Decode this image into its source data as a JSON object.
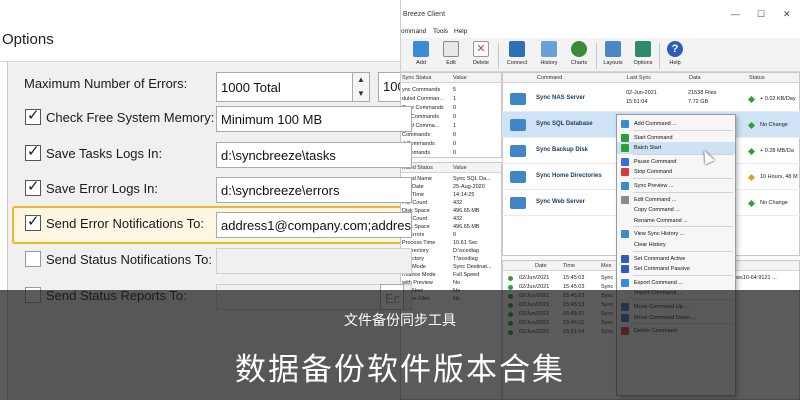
{
  "options_dialog": {
    "title": "Options",
    "max_errors": {
      "label": "Maximum Number of Errors:",
      "value": "1000 Total",
      "extra": "100"
    },
    "rows": [
      {
        "label": "Check Free System Memory:",
        "value": "Minimum 100 MB",
        "checked": true
      },
      {
        "label": "Save Tasks Logs In:",
        "value": "d:\\syncbreeze\\tasks",
        "checked": true
      },
      {
        "label": "Save Error Logs In:",
        "value": "d:\\syncbreeze\\errors",
        "checked": true
      },
      {
        "label": "Send Error Notifications To:",
        "value": "address1@company.com;address",
        "checked": true
      },
      {
        "label": "Send Status Notifications To:",
        "value": "",
        "checked": false
      },
      {
        "label": "Send Status Reports To:",
        "value": "",
        "checked": false
      }
    ],
    "extra_button": "Ec"
  },
  "app": {
    "title": "Breeze Client",
    "menu": [
      "ommand",
      "Tools",
      "Help"
    ],
    "toolbar": [
      "Add",
      "Edit",
      "Delete",
      "Connect",
      "History",
      "Charts",
      "Layouts",
      "Options",
      "Help"
    ],
    "status_panel": {
      "headers": [
        "Sync Status",
        "Value"
      ],
      "rows": [
        [
          "ync Commands",
          "5"
        ],
        [
          "duled Comman...",
          "1"
        ],
        [
          "Time Commands",
          "0"
        ],
        [
          "ing Commands",
          "0"
        ],
        [
          "leted Comma...",
          "1"
        ],
        [
          "Commands",
          "0"
        ],
        [
          "d Commands",
          "0"
        ],
        [
          "Commands",
          "0"
        ]
      ]
    },
    "detail_panel": {
      "headers": [
        "mand Status",
        "Value"
      ],
      "rows": [
        [
          "mand Name",
          "Sync SQL Da..."
        ],
        [
          "ync Date",
          "25-Aug-2020"
        ],
        [
          "ync Time",
          "14:14:25"
        ],
        [
          "File Count",
          "432"
        ],
        [
          "Disk Space",
          "496.65 MB"
        ],
        [
          "File Count",
          "432"
        ],
        [
          "Disk Space",
          "496.65 MB"
        ],
        [
          "nc Errors",
          "0"
        ],
        [
          "Process Time",
          "10.61 Sec"
        ],
        [
          "e Directory",
          "D:\\scediag"
        ],
        [
          "Directory",
          "T:\\scediag"
        ],
        [
          "ync Mode",
          "Sync Destinat..."
        ],
        [
          "rmance Mode",
          "Full Speed"
        ],
        [
          "with Preview",
          "No"
        ],
        [
          "ync Now",
          "No"
        ],
        [
          "rchive Files",
          "No"
        ]
      ]
    },
    "commands": {
      "headers": [
        "Command",
        "Last Sync",
        "Data",
        "Status"
      ],
      "rows": [
        {
          "name": "Sync NAS Server",
          "last_sync": "02-Jun-2021",
          "last_time": "15:51:04",
          "files": "21538 Files",
          "size": "7.72 GB",
          "status": "+ 0.02 KB/Day",
          "status_color": "#2e9e3a"
        },
        {
          "name": "Sync SQL Database",
          "last_sync": "",
          "last_time": "",
          "files": "",
          "size": "",
          "status": "No Change",
          "status_color": "#2e9e3a"
        },
        {
          "name": "Sync Backup Disk",
          "last_sync": "",
          "last_time": "",
          "files": "",
          "size": "",
          "status": "+ 0.28 MB/Da",
          "status_color": "#2e9e3a"
        },
        {
          "name": "Sync Home Directories",
          "last_sync": "",
          "last_time": "",
          "files": "",
          "size": "",
          "status": "10 Hours, 48 M",
          "status_color": "#e0a020"
        },
        {
          "name": "Sync Web Server",
          "last_sync": "",
          "last_time": "",
          "files": "",
          "size": "",
          "status": "No Change",
          "status_color": "#2e9e3a"
        }
      ]
    },
    "log": {
      "headers": [
        "Date",
        "Time",
        "Mes"
      ],
      "rows": [
        [
          "02/Jun/2021",
          "15:45:03",
          "Sync"
        ],
        [
          "02/Jun/2021",
          "15:45:03",
          "Sync"
        ],
        [
          "02/Jun/2021",
          "15:45:03",
          "Sync"
        ],
        [
          "02/Jun/2021",
          "15:45:13",
          "Sync"
        ],
        [
          "02/Jun/2021",
          "15:45:21",
          "Sync"
        ],
        [
          "02/Jun/2021",
          "15:46:01",
          "Sync"
        ],
        [
          "02/Jun/2021",
          "15:51:04",
          "Sync"
        ]
      ],
      "fragment": "ows10-64:9121 ..."
    },
    "context_menu": [
      {
        "label": "Add Command ...",
        "color": "#3a8ad6"
      },
      {
        "sep": true
      },
      {
        "label": "Start Command",
        "color": "#2e9e3a"
      },
      {
        "label": "Batch Start",
        "color": "#2e9e3a",
        "selected": true
      },
      {
        "sep": true
      },
      {
        "label": "Pause Command",
        "color": "#3a6fd6"
      },
      {
        "label": "Stop Command",
        "color": "#d63a3a"
      },
      {
        "sep": true
      },
      {
        "label": "Sync Preview ...",
        "color": "#3a8ad6"
      },
      {
        "sep": true
      },
      {
        "label": "Edit Command ...",
        "color": "#8a8a8a"
      },
      {
        "label": "Copy Command ...",
        "color": ""
      },
      {
        "label": "Rename Command ...",
        "color": ""
      },
      {
        "sep": true
      },
      {
        "label": "View Sync History ...",
        "color": "#3a8ad6"
      },
      {
        "label": "Clear History",
        "color": ""
      },
      {
        "sep": true
      },
      {
        "label": "Set Command Active",
        "color": "#2e5cb8"
      },
      {
        "label": "Set Command Passive",
        "color": "#2e5cb8"
      },
      {
        "sep": true
      },
      {
        "label": "Export Command ...",
        "color": "#3a8ad6"
      },
      {
        "label": "Import Command ...",
        "color": ""
      },
      {
        "sep": true
      },
      {
        "label": "Move Command Up ...",
        "color": "#3a6fd6"
      },
      {
        "label": "Move Command Down ...",
        "color": "#3a6fd6"
      },
      {
        "sep": true
      },
      {
        "label": "Delete Command",
        "color": "#d63a3a"
      }
    ]
  },
  "banner": {
    "subtitle": "文件备份同步工具",
    "title": "数据备份软件版本合集"
  }
}
